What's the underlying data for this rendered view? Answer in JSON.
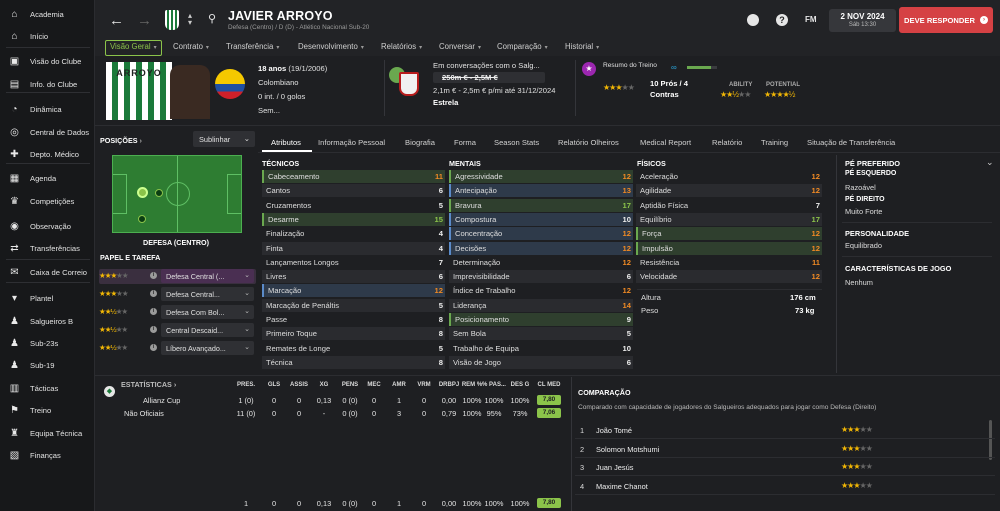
{
  "sidebar": [
    {
      "icon": "home-icon",
      "label": "Academia"
    },
    {
      "icon": "home-icon",
      "label": "Início"
    },
    {
      "icon": "club-icon",
      "label": "Visão do Clube"
    },
    {
      "icon": "info-icon",
      "label": "Info. do Clube"
    },
    {
      "icon": "dynamics-icon",
      "label": "Dinâmica"
    },
    {
      "icon": "data-icon",
      "label": "Central de Dados"
    },
    {
      "icon": "medical-icon",
      "label": "Depto. Médico"
    },
    {
      "icon": "calendar-icon",
      "label": "Agenda"
    },
    {
      "icon": "trophy-icon",
      "label": "Competições"
    },
    {
      "icon": "scout-icon",
      "label": "Observação"
    },
    {
      "icon": "transfer-icon",
      "label": "Transferências"
    },
    {
      "icon": "mail-icon",
      "label": "Caixa de Correio"
    },
    {
      "icon": "shirt-icon",
      "label": "Plantel"
    },
    {
      "icon": "squad-icon",
      "label": "Salgueiros B"
    },
    {
      "icon": "squad-icon",
      "label": "Sub-23s"
    },
    {
      "icon": "squad-icon",
      "label": "Sub-19"
    },
    {
      "icon": "tactics-icon",
      "label": "Tácticas"
    },
    {
      "icon": "training-icon",
      "label": "Treino"
    },
    {
      "icon": "staff-icon",
      "label": "Equipa Técnica"
    },
    {
      "icon": "finance-icon",
      "label": "Finanças"
    }
  ],
  "header": {
    "name": "JAVIER ARROYO",
    "subtitle": "Defesa (Centro) / D (D) - Atlético Nacional Sub-20",
    "fm_label": "FM",
    "date": "2 NOV 2024",
    "day_time": "Sáb 13:30",
    "respond_label": "DEVE RESPONDER"
  },
  "top_tabs": [
    "Visão Geral",
    "Contrato",
    "Transferência",
    "Desenvolvimento",
    "Relatórios",
    "Conversar",
    "Comparação",
    "Historial"
  ],
  "profile": {
    "shirt_name": "ARROYO",
    "age": "18 anos",
    "dob": "(19/1/2006)",
    "nationality": "Colombiano",
    "caps": "0 int. / 0 golos",
    "wage": "Sem...",
    "talks": "Em conversações com o Salg...",
    "value_old": "250m € - 2,5M €",
    "value_new": "2,1m € - 2,5m € p/mi até 31/12/2024",
    "status": "Estrela",
    "training_title": "Resumo do Treino",
    "pros_contras": "10 Prós / 4",
    "contras": "Contras",
    "ability_label": "ABILITY",
    "potential_label": "POTENTIAL",
    "ability_stars": 2.5,
    "potential_stars": 4.5,
    "training_stars": 3
  },
  "content_tabs": [
    "Atributos",
    "Informação Pessoal",
    "Biografia",
    "Forma",
    "Season Stats",
    "Relatório Olheiros",
    "Medical Report",
    "Relatório",
    "Training",
    "Situação de Transferência"
  ],
  "positions": {
    "title": "POSIÇÕES",
    "selector": "Sublinhar",
    "position_label": "DEFESA (CENTRO)"
  },
  "roles": {
    "title": "PAPEL E TAREFA",
    "items": [
      {
        "stars": "★★★☆☆",
        "label": "Defesa Central (..."
      },
      {
        "stars": "★★★☆☆",
        "label": "Defesa Central..."
      },
      {
        "stars": "★★½☆☆",
        "label": "Defesa Com Bol..."
      },
      {
        "stars": "★★½☆☆",
        "label": "Central Descaid..."
      },
      {
        "stars": "★★½☆☆",
        "label": "Líbero Avançado..."
      }
    ]
  },
  "attributes": {
    "tecnicos_title": "TÉCNICOS",
    "mentais_title": "MENTAIS",
    "fisicos_title": "FÍSICOS",
    "tecnicos": [
      {
        "n": "Cabeceamento",
        "v": "11",
        "hl": "g"
      },
      {
        "n": "Cantos",
        "v": "6",
        "hl": ""
      },
      {
        "n": "Cruzamentos",
        "v": "5",
        "hl": ""
      },
      {
        "n": "Desarme",
        "v": "15",
        "hl": "g"
      },
      {
        "n": "Finalização",
        "v": "4",
        "hl": ""
      },
      {
        "n": "Finta",
        "v": "4",
        "hl": ""
      },
      {
        "n": "Lançamentos Longos",
        "v": "7",
        "hl": ""
      },
      {
        "n": "Livres",
        "v": "6",
        "hl": ""
      },
      {
        "n": "Marcação",
        "v": "12",
        "hl": "b"
      },
      {
        "n": "Marcação de Penáltis",
        "v": "5",
        "hl": ""
      },
      {
        "n": "Passe",
        "v": "8",
        "hl": ""
      },
      {
        "n": "Primeiro Toque",
        "v": "8",
        "hl": ""
      },
      {
        "n": "Remates de Longe",
        "v": "5",
        "hl": ""
      },
      {
        "n": "Técnica",
        "v": "8",
        "hl": ""
      }
    ],
    "mentais": [
      {
        "n": "Agressividade",
        "v": "12",
        "hl": "g"
      },
      {
        "n": "Antecipação",
        "v": "13",
        "hl": "b"
      },
      {
        "n": "Bravura",
        "v": "17",
        "hl": "g"
      },
      {
        "n": "Compostura",
        "v": "10",
        "hl": "b"
      },
      {
        "n": "Concentração",
        "v": "12",
        "hl": "b"
      },
      {
        "n": "Decisões",
        "v": "12",
        "hl": "b"
      },
      {
        "n": "Determinação",
        "v": "12",
        "hl": ""
      },
      {
        "n": "Imprevisibilidade",
        "v": "6",
        "hl": ""
      },
      {
        "n": "Índice de Trabalho",
        "v": "12",
        "hl": ""
      },
      {
        "n": "Liderança",
        "v": "14",
        "hl": ""
      },
      {
        "n": "Posicionamento",
        "v": "9",
        "hl": "g"
      },
      {
        "n": "Sem Bola",
        "v": "5",
        "hl": ""
      },
      {
        "n": "Trabalho de Equipa",
        "v": "10",
        "hl": ""
      },
      {
        "n": "Visão de Jogo",
        "v": "6",
        "hl": ""
      }
    ],
    "fisicos": [
      {
        "n": "Aceleração",
        "v": "12",
        "hl": ""
      },
      {
        "n": "Agilidade",
        "v": "12",
        "hl": ""
      },
      {
        "n": "Aptidão Física",
        "v": "7",
        "hl": ""
      },
      {
        "n": "Equilíbrio",
        "v": "17",
        "hl": ""
      },
      {
        "n": "Força",
        "v": "12",
        "hl": "g"
      },
      {
        "n": "Impulsão",
        "v": "12",
        "hl": "g"
      },
      {
        "n": "Resistência",
        "v": "11",
        "hl": ""
      },
      {
        "n": "Velocidade",
        "v": "12",
        "hl": ""
      }
    ],
    "altura_label": "Altura",
    "altura": "176 cm",
    "peso_label": "Peso",
    "peso": "73 kg"
  },
  "side": {
    "pe_pref_title": "PÉ PREFERIDO",
    "pe_esq_title": "PÉ ESQUERDO",
    "pe_esq": "Razoável",
    "pe_dir_title": "PÉ DIREITO",
    "pe_dir": "Muito Forte",
    "pers_title": "PERSONALIDADE",
    "pers": "Equilibrado",
    "carac_title": "CARACTERÍSTICAS DE JOGO",
    "carac": "Nenhum"
  },
  "stats": {
    "title": "ESTATÍSTICAS",
    "headers": [
      "PRES.",
      "GLS",
      "ASSIS",
      "XG",
      "PENS",
      "MEC",
      "AMR",
      "VRM",
      "DRBPJ",
      "REM %",
      "% PAS...",
      "DES G",
      "CL MED"
    ],
    "rows": [
      {
        "label": "Allianz Cup",
        "vals": [
          "1 (0)",
          "0",
          "0",
          "0,13",
          "0 (0)",
          "0",
          "1",
          "0",
          "0,00",
          "100%",
          "100%",
          "100%"
        ],
        "rating": "7,80"
      },
      {
        "label": "Não Oficiais",
        "vals": [
          "11 (0)",
          "0",
          "0",
          "-",
          "0 (0)",
          "0",
          "3",
          "0",
          "0,79",
          "100%",
          "95%",
          "73%"
        ],
        "rating": "7,06"
      },
      {
        "label": "",
        "vals": [
          "",
          "",
          "",
          "",
          "",
          "",
          "",
          "",
          "",
          "",
          "",
          "",
          ""
        ],
        "rating": "7,80"
      }
    ],
    "bottom_vals": [
      "1",
      "0",
      "0",
      "0,13",
      "0 (0)",
      "0",
      "1",
      "0",
      "0,00",
      "100%",
      "100%",
      "100%"
    ]
  },
  "comparison": {
    "title": "COMPARAÇÃO",
    "subtitle": "Comparado com capacidade de jogadores do Salgueiros adequados para jogar como Defesa (Direito)",
    "items": [
      {
        "rank": "1",
        "name": "João Tomé",
        "stars": "★★★☆☆"
      },
      {
        "rank": "2",
        "name": "Solomon Motshumi",
        "stars": "★★★☆☆"
      },
      {
        "rank": "3",
        "name": "Juan Jesús",
        "stars": "★★★☆☆"
      },
      {
        "rank": "4",
        "name": "Maxime Chanot",
        "stars": "★★★☆☆"
      }
    ]
  }
}
